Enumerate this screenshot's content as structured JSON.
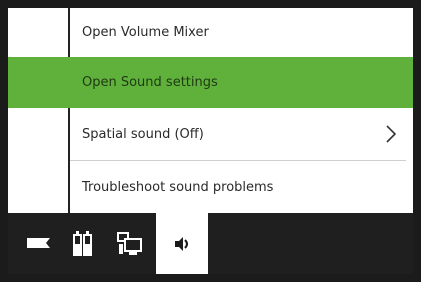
{
  "menu": {
    "items": [
      {
        "label": "Open Volume Mixer",
        "highlighted": false,
        "has_submenu": false
      },
      {
        "label": "Open Sound settings",
        "highlighted": true,
        "has_submenu": false
      },
      {
        "label": "Spatial sound (Off)",
        "highlighted": false,
        "has_submenu": true
      },
      {
        "label": "Troubleshoot sound problems",
        "highlighted": false,
        "has_submenu": false
      }
    ]
  },
  "taskbar": {
    "icons": [
      {
        "name": "arrow-flag-icon"
      },
      {
        "name": "battery-icon"
      },
      {
        "name": "network-icon"
      },
      {
        "name": "volume-icon",
        "active": true
      }
    ]
  },
  "colors": {
    "highlight": "#5fb13b",
    "taskbar": "#1f1f1f",
    "border": "#1b1b1b"
  }
}
